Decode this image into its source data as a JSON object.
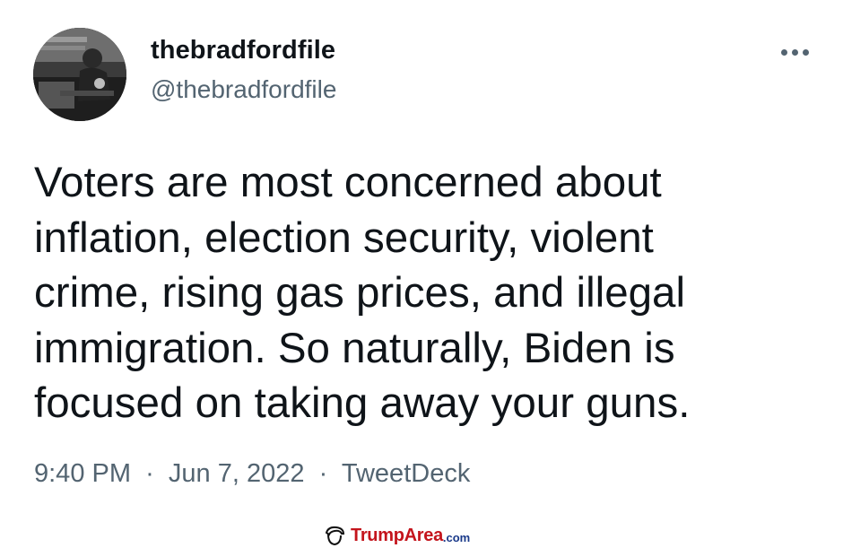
{
  "tweet": {
    "author": {
      "display_name": "thebradfordfile",
      "handle": "@thebradfordfile"
    },
    "text_lines": [
      "Voters are most concerned about",
      "inflation, election security, violent",
      "crime, rising gas prices, and illegal",
      "immigration. So naturally, Biden is",
      "focused on taking away your guns."
    ],
    "time": "9:40 PM",
    "separator": "·",
    "date": "Jun 7, 2022",
    "source": "TweetDeck",
    "more_icon": "more-horizontal-icon"
  },
  "watermark": {
    "name": "TrumpArea",
    "tld": ".com"
  },
  "colors": {
    "text_primary": "#0f1419",
    "text_secondary": "#536471",
    "watermark_red": "#c4141c",
    "watermark_blue": "#1a3a8a"
  }
}
